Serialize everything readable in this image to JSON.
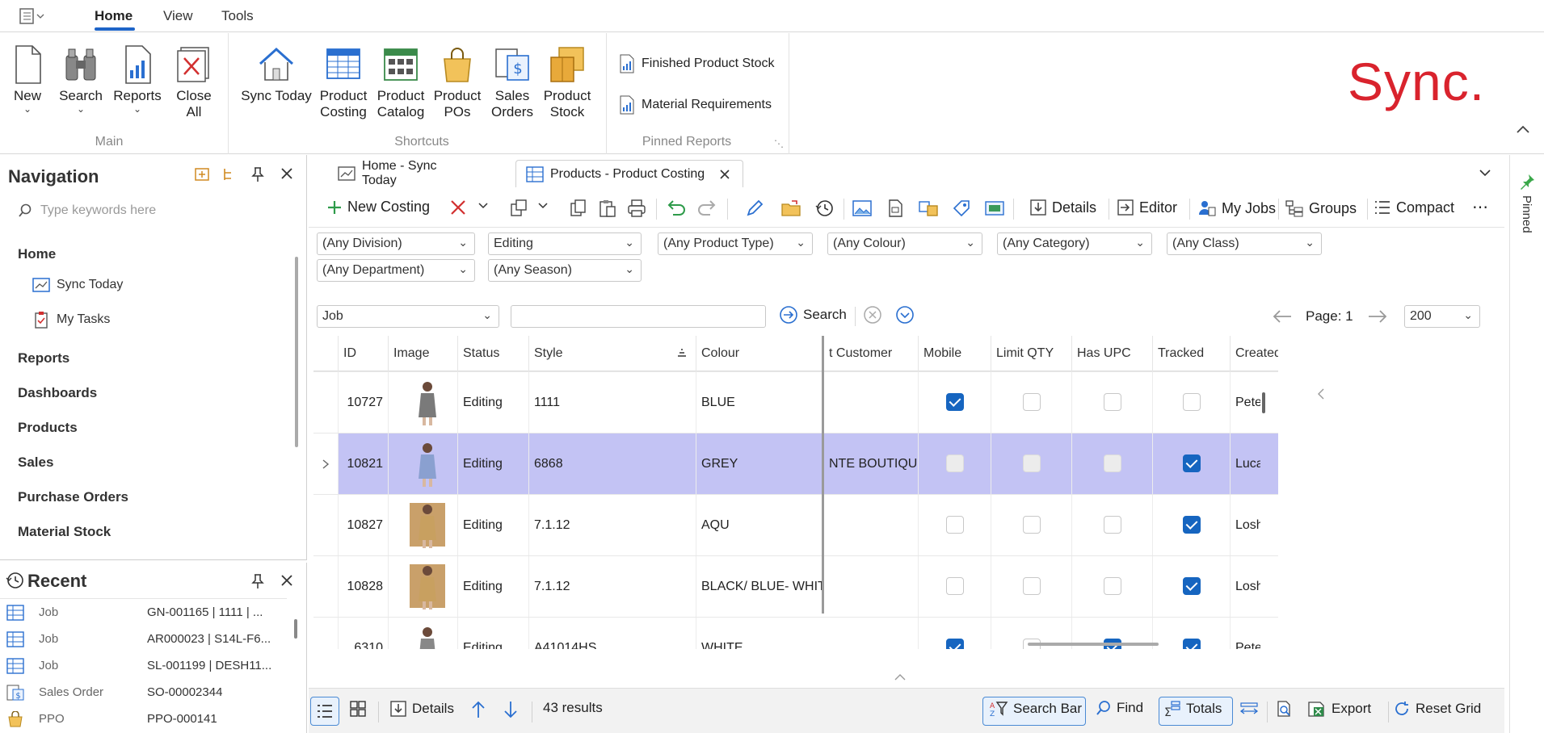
{
  "menu": {
    "tabs": [
      "Home",
      "View",
      "Tools"
    ]
  },
  "ribbon": {
    "main": {
      "group_label": "Main",
      "new": "New",
      "search": "Search",
      "reports": "Reports",
      "close_all_1": "Close",
      "close_all_2": "All"
    },
    "shortcuts": {
      "group_label": "Shortcuts",
      "sync_today": "Sync Today",
      "product_costing": [
        "Product",
        "Costing"
      ],
      "product_catalog": [
        "Product",
        "Catalog"
      ],
      "product_pos": [
        "Product",
        "POs"
      ],
      "sales_orders": [
        "Sales",
        "Orders"
      ],
      "product_stock": [
        "Product",
        "Stock"
      ]
    },
    "pinned": {
      "group_label": "Pinned Reports",
      "items": [
        "Finished Product Stock",
        "Material Requirements"
      ]
    },
    "brand": "Sync."
  },
  "navigation": {
    "title": "Navigation",
    "search_placeholder": "Type keywords here",
    "sections": [
      "Home",
      "Reports",
      "Dashboards",
      "Products",
      "Sales",
      "Purchase Orders",
      "Material Stock"
    ],
    "home_items": [
      "Sync Today",
      "My Tasks"
    ]
  },
  "recent": {
    "title": "Recent",
    "rows": [
      {
        "type": "Job",
        "value": "GN-001165 | 1111 | ..."
      },
      {
        "type": "Job",
        "value": "AR000023 | S14L-F6..."
      },
      {
        "type": "Job",
        "value": "SL-001199 | DESH11..."
      },
      {
        "type": "Sales Order",
        "value": "SO-00002344"
      },
      {
        "type": "PPO",
        "value": "PPO-000141"
      }
    ]
  },
  "side_panel": {
    "pinned": "Pinned"
  },
  "tabs": [
    "Home - Sync Today",
    "Products - Product Costing"
  ],
  "toolbar": {
    "new_costing": "New Costing",
    "details": "Details",
    "editor": "Editor",
    "my_jobs": "My Jobs",
    "groups": "Groups",
    "compact": "Compact"
  },
  "filters": {
    "division": "(Any Division)",
    "status": "Editing",
    "product_type": "(Any Product Type)",
    "colour": "(Any Colour)",
    "category": "(Any Category)",
    "class": "(Any Class)",
    "department": "(Any Department)",
    "season": "(Any Season)"
  },
  "searchbar": {
    "field": "Job",
    "search_label": "Search",
    "page_label": "Page: 1",
    "page_size": "200"
  },
  "grid": {
    "columns": [
      "ID",
      "Image",
      "Status",
      "Style",
      "Colour",
      "t Customer",
      "Mobile",
      "Limit QTY",
      "Has UPC",
      "Tracked",
      "Created"
    ],
    "rows": [
      {
        "id": "10727",
        "status": "Editing",
        "style": "1111",
        "colour": "BLUE",
        "customer": "",
        "mobile": true,
        "limit": false,
        "upc": false,
        "tracked": false,
        "created": "Peter",
        "selected": false
      },
      {
        "id": "10821",
        "status": "Editing",
        "style": "6868",
        "colour": "GREY",
        "customer": "NTE BOUTIQUE",
        "mobile": false,
        "limit": false,
        "upc": false,
        "tracked": true,
        "created": "Luca",
        "selected": true
      },
      {
        "id": "10827",
        "status": "Editing",
        "style": "7.1.12",
        "colour": "AQU",
        "customer": "",
        "mobile": false,
        "limit": false,
        "upc": false,
        "tracked": true,
        "created": "Loshr",
        "selected": false
      },
      {
        "id": "10828",
        "status": "Editing",
        "style": "7.1.12",
        "colour": "BLACK/ BLUE- WHITE",
        "customer": "",
        "mobile": false,
        "limit": false,
        "upc": false,
        "tracked": true,
        "created": "Loshr",
        "selected": false
      },
      {
        "id": "6310",
        "status": "Editing",
        "style": "A41014HS",
        "colour": "WHITE",
        "customer": "",
        "mobile": true,
        "limit": false,
        "upc": true,
        "tracked": true,
        "created": "Peter",
        "selected": false
      }
    ]
  },
  "statusbar": {
    "details": "Details",
    "results": "43 results",
    "search_bar": "Search Bar",
    "find": "Find",
    "totals": "Totals",
    "export": "Export",
    "reset_grid": "Reset Grid"
  },
  "colors": {
    "accent": "#1e64c8",
    "selected_row": "#c3c3f4",
    "checkbox": "#1665c0",
    "brand_red": "#d9232d"
  }
}
